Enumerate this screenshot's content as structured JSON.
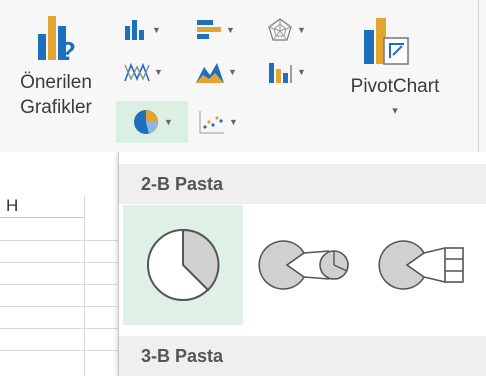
{
  "ribbon": {
    "recommended_label_1": "Önerilen",
    "recommended_label_2": "Grafikler",
    "pivot_label": "PivotChart",
    "pivot_arrow": "▾"
  },
  "sheet": {
    "column_header": "H"
  },
  "gallery": {
    "section_2d": "2-B Pasta",
    "section_3d": "3-B Pasta"
  },
  "colors": {
    "accent_green_selection": "#dff0e6",
    "pie_gray": "#d0d0d0",
    "chart_blue": "#1f6fbf",
    "chart_orange": "#e3a530"
  }
}
